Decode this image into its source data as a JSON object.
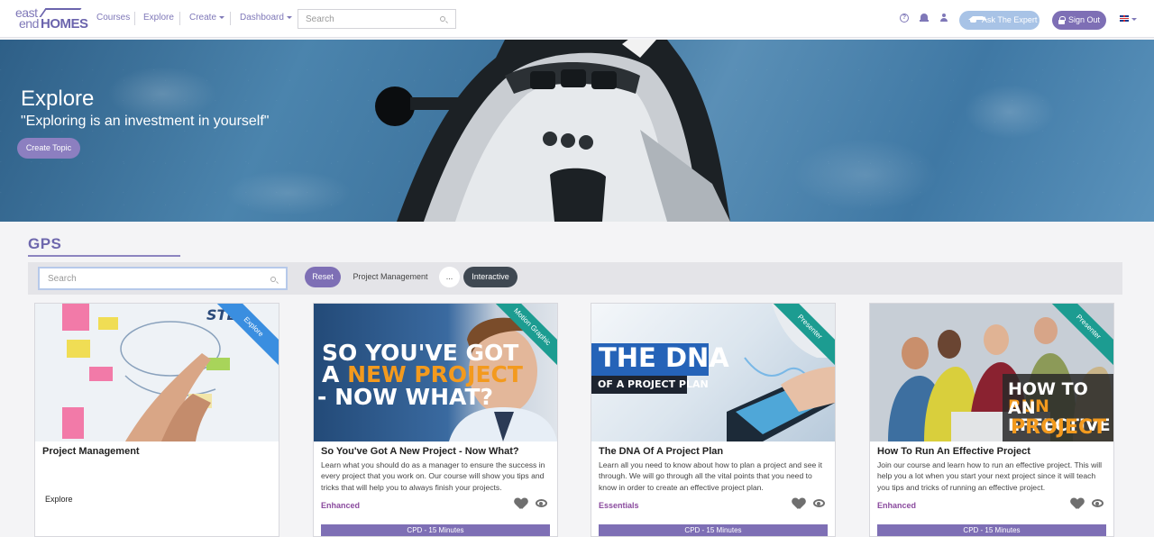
{
  "brand": {
    "line1": "east",
    "line2": "end",
    "line3": "HOMES"
  },
  "nav": {
    "courses": "Courses",
    "explore": "Explore",
    "create": "Create",
    "dashboard": "Dashboard",
    "search_placeholder": "Search",
    "ask_expert": "Ask The Expert",
    "sign_out": "Sign Out",
    "help_glyph": "?"
  },
  "hero": {
    "title": "Explore",
    "quote": "\"Exploring is an investment in yourself\"",
    "create_topic": "Create Topic"
  },
  "section": {
    "title": "GPS",
    "search_placeholder": "Search",
    "filters": {
      "reset": "Reset",
      "project_management": "Project Management",
      "more": "...",
      "interactive": "Interactive"
    }
  },
  "cards": [
    {
      "title": "Project Management",
      "ribbon": "Explore",
      "ribbon_color": "#3a8ee0",
      "plain_tag": "Explore",
      "thumb_text": "STEP"
    },
    {
      "title": "So You've Got A New Project - Now What?",
      "ribbon": "Motion Graphic",
      "ribbon_color": "#1c9c91",
      "thumb_line1": "SO YOU'VE GOT",
      "thumb_line2a": "A ",
      "thumb_line2b": "NEW PROJECT",
      "thumb_line3": "- NOW WHAT?",
      "desc": "Learn what you should do as a manager to ensure the success in every project that you work on. Our course will show you tips and tricks that will help you to always finish your projects.",
      "tag": "Enhanced",
      "cpd": "CPD - 15 Minutes"
    },
    {
      "title": "The DNA Of A Project Plan",
      "ribbon": "Presenter",
      "ribbon_color": "#1c9c91",
      "thumb_line1": "THE DNA",
      "thumb_line2": "OF A PROJECT PLAN",
      "desc": "Learn all you need to know about how to plan a project and see it through. We will go through all the vital points that you need to know in order to create an effective project plan.",
      "tag": "Essentials",
      "cpd": "CPD - 15 Minutes"
    },
    {
      "title": "How To Run An Effective Project",
      "ribbon": "Presenter",
      "ribbon_color": "#1c9c91",
      "thumb_line1a": "HOW TO ",
      "thumb_line1b": "RUN",
      "thumb_line2": "AN EFFECTIVE",
      "thumb_line3": "PROJECT",
      "desc": "Join our course and learn how to run an effective project. This will help you a lot when you start your next project since it will teach you tips and tricks of running an effective project.",
      "tag": "Enhanced",
      "cpd": "CPD - 15 Minutes"
    }
  ],
  "colors": {
    "brand": "#7e6fb5",
    "accent_orange": "#f39a1e",
    "ribbon_blue": "#3a8ee0",
    "ribbon_teal": "#1c9c91"
  }
}
